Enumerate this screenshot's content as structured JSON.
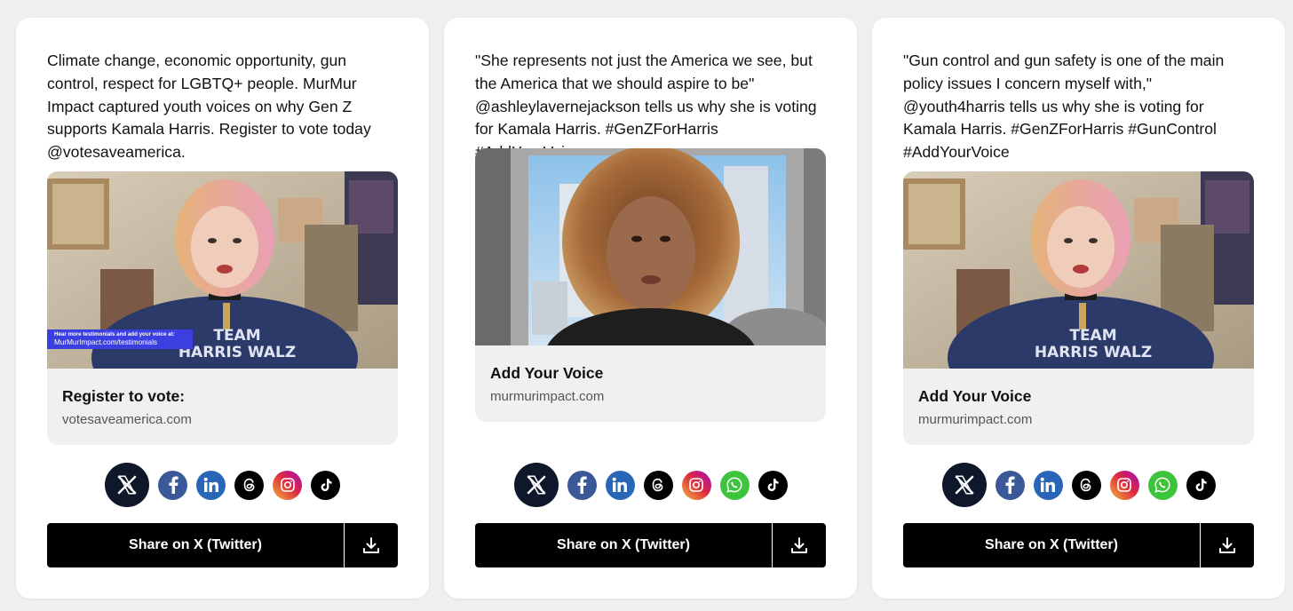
{
  "cards": [
    {
      "text": "Climate change, economic opportunity, gun control, respect for LGBTQ+ people. MurMur Impact captured youth voices on why Gen Z supports Kamala Harris. Register to vote today @votesaveamerica.",
      "preview_title": "Register to vote:",
      "preview_domain": "votesaveamerica.com",
      "banner_line1": "Hear more testimonials and add your voice at:",
      "banner_line2": "MurMurImpact.com/testimonials",
      "shirt_line1": "TEAM",
      "shirt_line2": "HARRIS WALZ",
      "share_label": "Share on X (Twitter)"
    },
    {
      "text": "\"She represents not just the America we see, but the America that we should aspire to be\" @ashleylavernejackson tells us why she is voting for Kamala Harris. #GenZForHarris #AddYourVoice",
      "preview_title": "Add Your Voice",
      "preview_domain": "murmurimpact.com",
      "share_label": "Share on X (Twitter)"
    },
    {
      "text": "\"Gun control and gun safety is one of the main policy issues I concern myself with,\" @youth4harris tells us why she is voting for Kamala Harris. #GenZForHarris #GunControl #AddYourVoice",
      "preview_title": "Add Your Voice",
      "preview_domain": "murmurimpact.com",
      "shirt_line1": "TEAM",
      "shirt_line2": "HARRIS WALZ",
      "share_label": "Share on X (Twitter)"
    }
  ],
  "icons": {
    "card1_social": [
      "x-icon",
      "facebook-icon",
      "linkedin-icon",
      "threads-icon",
      "instagram-icon",
      "tiktok-icon"
    ],
    "card2_social": [
      "x-icon",
      "facebook-icon",
      "linkedin-icon",
      "threads-icon",
      "instagram-icon",
      "whatsapp-icon",
      "tiktok-icon"
    ],
    "card3_social": [
      "x-icon",
      "facebook-icon",
      "linkedin-icon",
      "threads-icon",
      "instagram-icon",
      "whatsapp-icon",
      "tiktok-icon"
    ],
    "download": "download-icon"
  },
  "colors": {
    "page_bg": "#efefef",
    "card_bg": "#ffffff",
    "preview_bg": "#f0f0f0",
    "share_bar": "#000000",
    "x_circle": "#0f172a",
    "facebook": "#3b5998",
    "linkedin": "#2a66b8",
    "whatsapp": "#3dc33c",
    "banner": "#3b3fe0"
  }
}
